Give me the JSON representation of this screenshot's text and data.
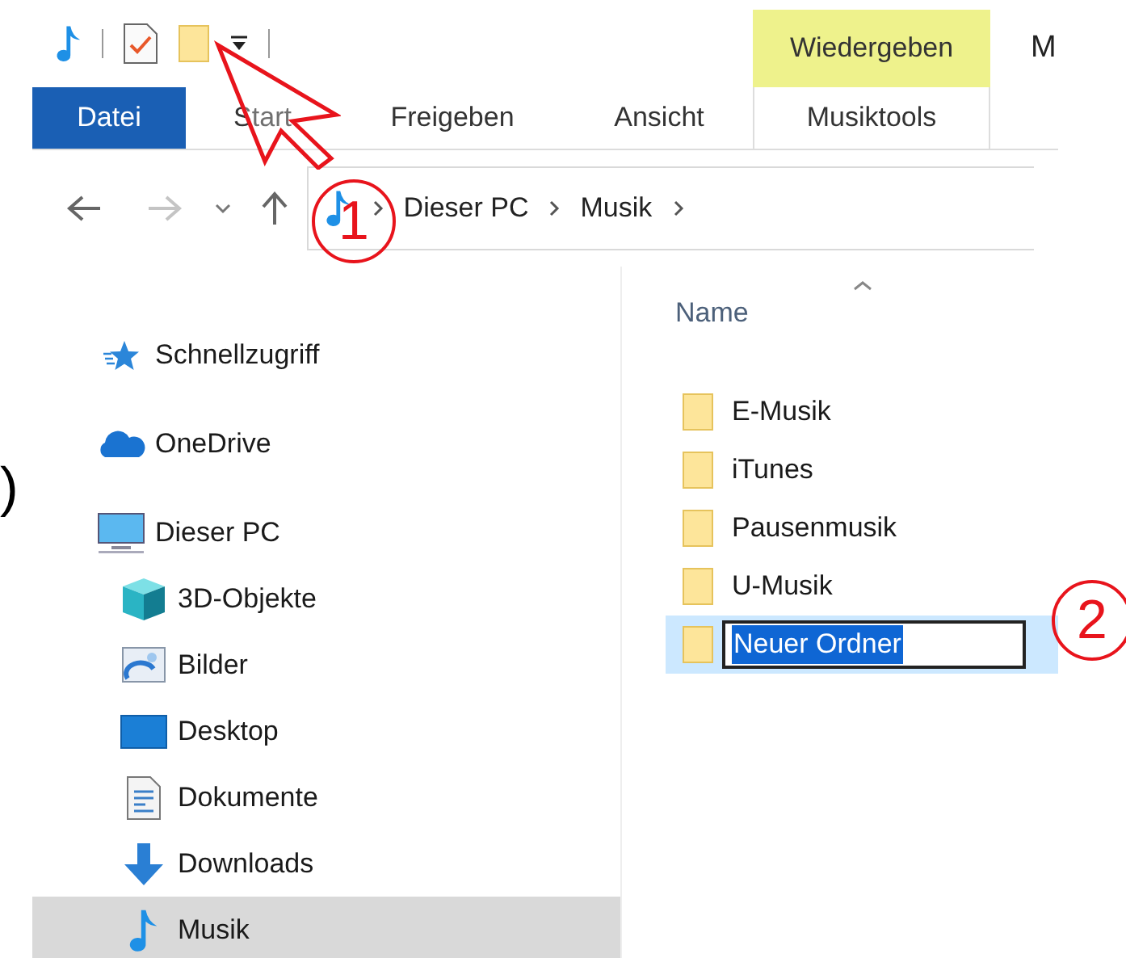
{
  "ribbon": {
    "contextual_group": "Wiedergeben",
    "cut_off_title": "M",
    "tabs": [
      {
        "label": "Datei",
        "kind": "file"
      },
      {
        "label": "Start",
        "kind": "tab"
      },
      {
        "label": "Freigeben",
        "kind": "tab"
      },
      {
        "label": "Ansicht",
        "kind": "tab"
      },
      {
        "label": "Musiktools",
        "kind": "contextual"
      }
    ]
  },
  "address_bar": {
    "path": [
      "Dieser PC",
      "Musik"
    ]
  },
  "stray_text": ")",
  "navigation": [
    {
      "label": "Schnellzugriff",
      "kind": "star",
      "selected": false
    },
    {
      "label": "OneDrive",
      "kind": "cloud",
      "selected": false
    },
    {
      "label": "Dieser PC",
      "kind": "pc",
      "selected": false,
      "children": [
        {
          "label": "3D-Objekte",
          "kind": "cube",
          "selected": false
        },
        {
          "label": "Bilder",
          "kind": "pictures",
          "selected": false
        },
        {
          "label": "Desktop",
          "kind": "desktop",
          "selected": false
        },
        {
          "label": "Dokumente",
          "kind": "document",
          "selected": false
        },
        {
          "label": "Downloads",
          "kind": "download",
          "selected": false
        },
        {
          "label": "Musik",
          "kind": "music",
          "selected": true
        }
      ]
    }
  ],
  "files": {
    "column": "Name",
    "items": [
      {
        "name": "E-Musik",
        "selected": false,
        "editing": false
      },
      {
        "name": "iTunes",
        "selected": false,
        "editing": false
      },
      {
        "name": "Pausenmusik",
        "selected": false,
        "editing": false
      },
      {
        "name": "U-Musik",
        "selected": false,
        "editing": false
      },
      {
        "name": "Neuer Ordner",
        "selected": true,
        "editing": true
      }
    ]
  },
  "annotations": [
    {
      "label": "1"
    },
    {
      "label": "2"
    }
  ]
}
